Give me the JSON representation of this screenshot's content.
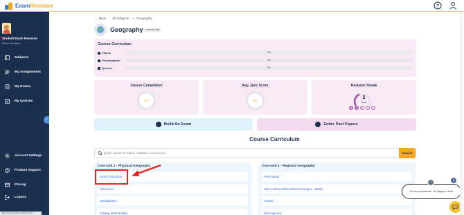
{
  "app": {
    "logo_text_a": "Exam",
    "logo_text_b": "Revision"
  },
  "sidebar": {
    "user_name": "Student Exam Revision",
    "user_sub": "Exam Revision",
    "items": [
      {
        "label": "Subjects",
        "icon": "book-icon"
      },
      {
        "label": "My Assignments",
        "icon": "users-icon"
      },
      {
        "label": "My Exams",
        "icon": "file-icon"
      },
      {
        "label": "My Quizzes",
        "icon": "check-icon"
      }
    ],
    "bottom_items": [
      {
        "label": "Account Settings",
        "icon": "gear-icon"
      },
      {
        "label": "Product Support",
        "icon": "help-icon"
      },
      {
        "label": "Pricing",
        "icon": "card-icon"
      },
      {
        "label": "Logout",
        "icon": "logout-icon"
      }
    ],
    "status_url": "https://examrevision-website.com/..."
  },
  "breadcrumb": {
    "back": "← Back",
    "all_subjects": "All Subjects",
    "sep": ">",
    "current": "Geography"
  },
  "subject": {
    "title": "Geography",
    "pill": "Leaving Cert"
  },
  "curriculum": {
    "title": "Course Curriculum",
    "rows": [
      {
        "label": "Videos",
        "value": "0%"
      },
      {
        "label": "Presentations",
        "value": "0%"
      },
      {
        "label": "Quizzes",
        "value": "0%"
      }
    ]
  },
  "stats": {
    "completion_title": "Course Completion",
    "completion_value": "0%",
    "quiz_title": "Avg. Quiz Score",
    "quiz_value": "0%",
    "streak_title": "Revision Streak",
    "streak_value": "2",
    "streak_unit": "Days",
    "days": [
      "M",
      "T",
      "W",
      "T",
      "F"
    ]
  },
  "actions": {
    "build_exam": "Build An Exam",
    "past_papers": "Entire Past Papers"
  },
  "section_title": "Course Curriculum",
  "search": {
    "placeholder": "Quick search for topics, chapters or resources",
    "button": "Search"
  },
  "units": [
    {
      "title": "Core Unit 1 - Physical Geography",
      "topics": [
        "Earth's Structure",
        "Volcanoes",
        "Earthquakes",
        "Folding and Faulting"
      ]
    },
    {
      "title": "Core Unit 2 - Regional Geography",
      "topics": [
        "Paris Basin",
        "Sub-Continental/Continental Region - Brazil",
        "Ireland",
        "Mezzogiorno"
      ]
    }
  ],
  "chat": {
    "bubble": "Got any questions? I'm happy to help.",
    "close": "×"
  },
  "colors": {
    "sidebar_bg": "#1b2f4f",
    "accent": "#f5a623",
    "card_pink": "#f8e9f5",
    "highlight": "#e8231a"
  }
}
